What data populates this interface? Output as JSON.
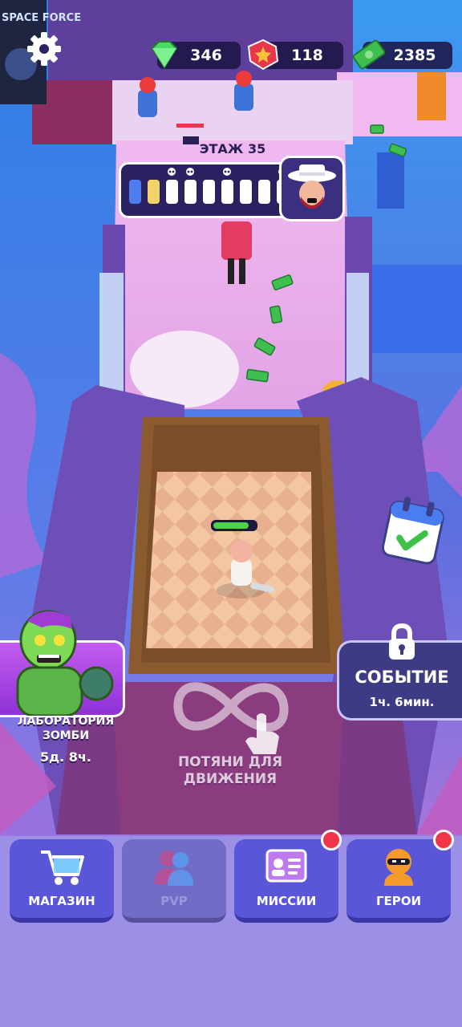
{
  "resources": {
    "gems": {
      "value": "346",
      "icon": "green-gem-icon",
      "color": "#4cd964"
    },
    "tokens": {
      "value": "118",
      "icon": "red-star-token-icon",
      "color": "#e8364b"
    },
    "cash": {
      "value": "2385",
      "icon": "cash-stack-icon",
      "color": "#3fbf4f"
    }
  },
  "level": {
    "title": "ЭТАЖ 35",
    "segments_filled": 2,
    "segments_total": 9,
    "skull_positions": [
      3,
      4,
      6,
      9
    ],
    "boss_icon": "boss-hat-portrait-icon"
  },
  "poster": {
    "text": "SPACE FORCE"
  },
  "player": {
    "health_fraction": 0.85
  },
  "zombie_lab": {
    "label": "ЛАБОРАТОРИЯ ЗОМБИ",
    "timer": "5д. 8ч.",
    "icon": "zombie-portrait-icon"
  },
  "event": {
    "label": "СОБЫТИЕ",
    "timer": "1ч. 6мин.",
    "icon": "padlock-icon"
  },
  "daily_calendar_icon": "calendar-check-icon",
  "hint": {
    "text": "ПОТЯНИ ДЛЯ ДВИЖЕНИЯ",
    "icon": "infinity-swipe-icon"
  },
  "nav": [
    {
      "label": "МАГАЗИН",
      "icon": "shopping-cart-icon",
      "disabled": false,
      "badge": false
    },
    {
      "label": "PVP",
      "icon": "pvp-icon",
      "disabled": true,
      "badge": false
    },
    {
      "label": "МИССИИ",
      "icon": "id-card-icon",
      "disabled": false,
      "badge": true
    },
    {
      "label": "ГЕРОИ",
      "icon": "ninja-hero-icon",
      "disabled": false,
      "badge": true
    }
  ]
}
